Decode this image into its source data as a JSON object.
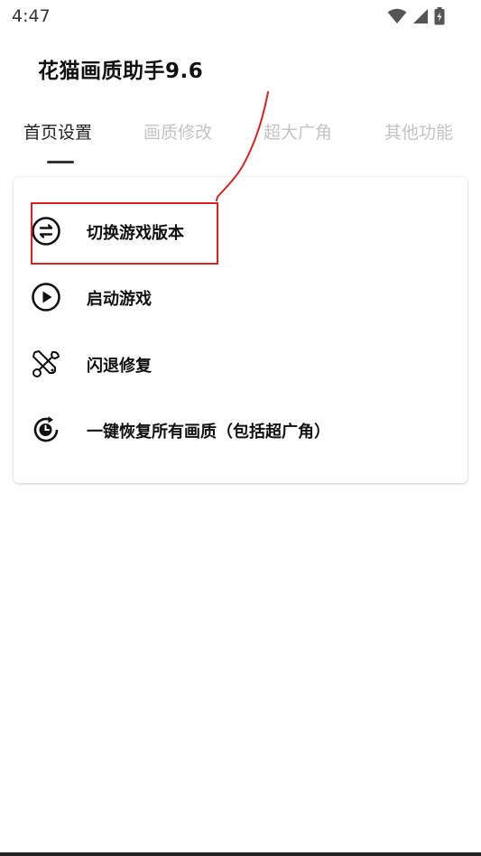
{
  "status_bar": {
    "time": "4:47"
  },
  "app": {
    "title": "花猫画质助手9.6"
  },
  "tabs": [
    {
      "label": "首页设置",
      "active": true
    },
    {
      "label": "画质修改",
      "active": false
    },
    {
      "label": "超大广角",
      "active": false
    },
    {
      "label": "其他功能",
      "active": false
    }
  ],
  "menu": {
    "items": [
      {
        "label": "切换游戏版本",
        "icon": "swap-icon"
      },
      {
        "label": "启动游戏",
        "icon": "play-icon"
      },
      {
        "label": "闪退修复",
        "icon": "tools-icon"
      },
      {
        "label": "一键恢复所有画质（包括超广角）",
        "icon": "restore-icon"
      }
    ]
  },
  "colors": {
    "annotation": "#e02020",
    "active_tab": "#222222",
    "inactive_tab": "#c4c4c4"
  }
}
